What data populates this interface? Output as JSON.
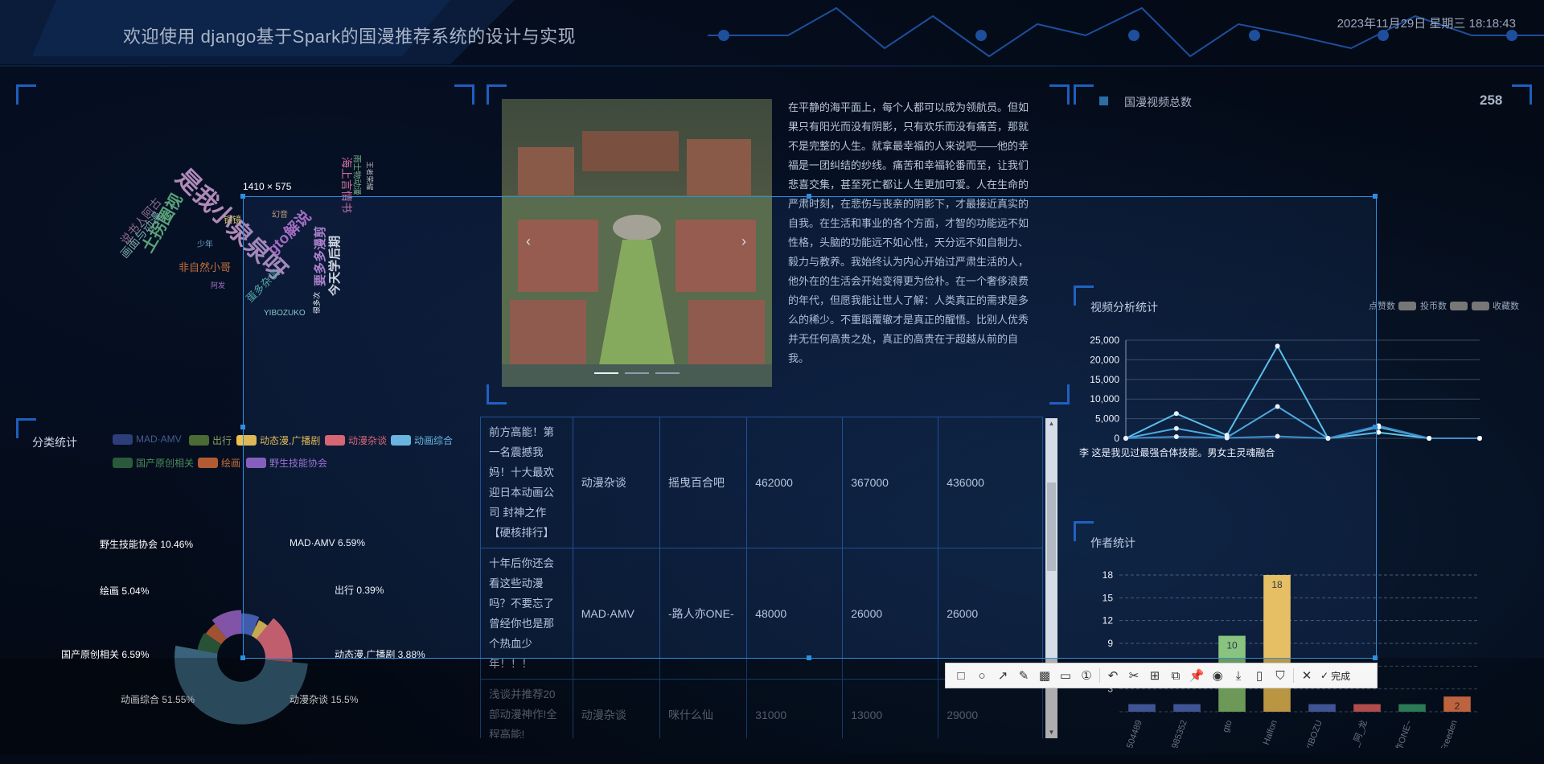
{
  "header": {
    "title": "欢迎使用 django基于Spark的国漫推荐系统的设计与实现",
    "datetime": "2023年11月29日 星期三 18:18:43"
  },
  "word_cloud": {
    "words": [
      "是我小泉泉呀",
      "土拐圈视",
      "gto解说",
      "今天学后期",
      "要多多漫剪",
      "非自然小哥",
      "画面与动漫",
      "说书人阿古",
      "YIBOZUKO",
      "海上言情书",
      "雨士物动漫",
      "幻音",
      "少年",
      "铜镜",
      "蛋多杂谈",
      "很多次",
      "阿发",
      "王者荣耀"
    ]
  },
  "carousel": {
    "prev": "‹",
    "next": "›"
  },
  "article": {
    "text": "在平静的海平面上，每个人都可以成为领航员。但如果只有阳光而没有阴影，只有欢乐而没有痛苦，那就不是完整的人生。就拿最幸福的人来说吧——他的幸福是一团纠结的纱线。痛苦和幸福轮番而至，让我们悲喜交集，甚至死亡都让人生更加可爱。人在生命的严肃时刻，在悲伤与丧亲的阴影下，才最接近真实的自我。在生活和事业的各个方面，才智的功能远不如性格，头脑的功能远不如心性，天分远不如自制力、毅力与教养。我始终认为内心开始过严肃生活的人，他外在的生活会开始变得更为俭朴。在一个奢侈浪费的年代，但愿我能让世人了解：人类真正的需求是多么的稀少。不重蹈覆辙才是真正的醒悟。比别人优秀并无任何高贵之处，真正的高贵在于超越从前的自我。"
  },
  "stat": {
    "label": "国漫视频总数",
    "value": "258"
  },
  "category_panel": {
    "title": "分类统计",
    "legend": [
      {
        "name": "MAD·AMV",
        "color": "#2c3e7a"
      },
      {
        "name": "出行",
        "color": "#5b7a3a"
      },
      {
        "name": "动态漫,广播剧",
        "color": "#f0c04a"
      },
      {
        "name": "动漫杂谈",
        "color": "#e8656a"
      },
      {
        "name": "动画综合",
        "color": "#6fbce2"
      },
      {
        "name": "国产原创相关",
        "color": "#2b5a3a"
      },
      {
        "name": "绘画",
        "color": "#b25a34"
      },
      {
        "name": "野生技能协会",
        "color": "#8f5cb8"
      }
    ],
    "pie_labels": {
      "mad": "MAD·AMV 6.59%",
      "chuxing": "出行 0.39%",
      "dongtai": "动态漫,广播剧 3.88%",
      "zatan": "动漫杂谈 15.5%",
      "zonghe": "动画综合 51.55%",
      "guochan": "国产原创相关 6.59%",
      "huihua": "绘画 5.04%",
      "yesheng": "野生技能协会 10.46%"
    }
  },
  "chart_data": [
    {
      "type": "pie",
      "title": "分类统计",
      "categories": [
        "MAD·AMV",
        "出行",
        "动态漫,广播剧",
        "动漫杂谈",
        "动画综合",
        "国产原创相关",
        "绘画",
        "野生技能协会"
      ],
      "values": [
        6.59,
        0.39,
        3.88,
        15.5,
        51.55,
        6.59,
        5.04,
        10.46
      ],
      "colors": [
        "#4a62b8",
        "#5b7a3a",
        "#f0c04a",
        "#e8656a",
        "#3f6d86",
        "#2b5a3a",
        "#b25a34",
        "#8f5cb8"
      ]
    },
    {
      "type": "line",
      "title": "视频分析统计",
      "legend": [
        "点赞数",
        "投币数",
        "收藏数"
      ],
      "x_label_visible": "李 这是我见过最强合体技能。男女主灵魂融合",
      "ylim": [
        0,
        25000
      ],
      "yticks": [
        "0",
        "5,000",
        "10,000",
        "15,000",
        "20,000",
        "25,000"
      ],
      "series": [
        {
          "name": "点赞数",
          "values": [
            0,
            6300,
            800,
            23500,
            0,
            1500,
            0,
            0
          ]
        },
        {
          "name": "投币数",
          "values": [
            0,
            2500,
            200,
            8100,
            0,
            2800,
            0,
            0
          ]
        },
        {
          "name": "收藏数",
          "values": [
            0,
            400,
            100,
            500,
            0,
            3200,
            0,
            0
          ]
        }
      ]
    },
    {
      "type": "bar",
      "title": "作者统计",
      "ylim": [
        0,
        18
      ],
      "yticks": [
        "3",
        "6",
        "9",
        "12",
        "15",
        "18"
      ],
      "categories": [
        "4504489",
        "6985352",
        "gto",
        "Halfon",
        "YIBOZU",
        "__阿_龙",
        "路人亦ONE~",
        "AusarFreeden"
      ],
      "values": [
        1,
        1,
        10,
        18,
        1,
        1,
        1,
        2
      ],
      "data_labels": [
        "",
        "",
        "10",
        "18",
        "",
        "",
        "",
        "2"
      ],
      "colors": [
        "#5470c6",
        "#5470c6",
        "#91cc75",
        "#fac858",
        "#5470c6",
        "#ee6666",
        "#3ba272",
        "#fc8452"
      ]
    }
  ],
  "table": {
    "rows": [
      {
        "title": "前方高能！第一名震撼我妈！十大最欢迎日本动画公司 封神之作【硬核排行】",
        "category": "动漫杂谈",
        "author": "摇曳百合吧",
        "likes": "462000",
        "coins": "367000",
        "favs": "436000"
      },
      {
        "title": "十年后你还会看这些动漫吗？不要忘了曾经你也是那个热血少年！！！",
        "category": "MAD·AMV",
        "author": "-路人亦ONE-",
        "likes": "48000",
        "coins": "26000",
        "favs": "26000"
      },
      {
        "title": "浅谈并推荐20部动漫神作!全程高能!",
        "category": "动漫杂谈",
        "author": "咪什么仙",
        "likes": "31000",
        "coins": "13000",
        "favs": "29000"
      }
    ]
  },
  "video_panel": {
    "title": "视频分析统计",
    "legend": [
      "点赞数",
      "投币数",
      "收藏数"
    ]
  },
  "author_panel": {
    "title": "作者统计"
  },
  "selection": {
    "size_label": "1410 × 575"
  },
  "toolbar": {
    "done_label": "完成",
    "tools": [
      "rect",
      "ellipse",
      "arrow",
      "pen",
      "mosaic",
      "text",
      "serial-number",
      "undo",
      "redo-cut",
      "ocr",
      "translate",
      "pin",
      "record",
      "download",
      "long-screenshot",
      "bookmark",
      "close"
    ]
  }
}
